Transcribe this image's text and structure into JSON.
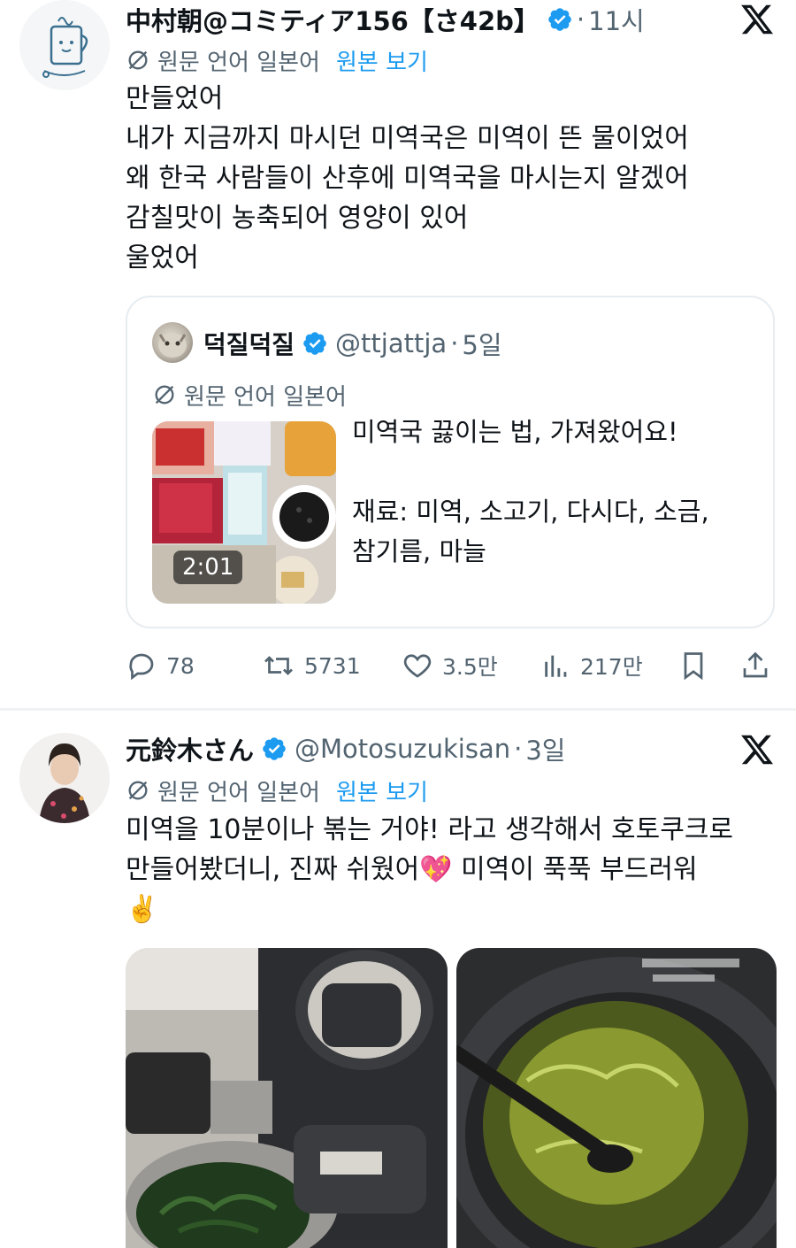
{
  "colors": {
    "text": "#0f1419",
    "secondary": "#536471",
    "link": "#1d9bf0",
    "verified": "#1d9bf0",
    "border": "#e6ecf0"
  },
  "tweets": [
    {
      "name": "中村朝@コミティア156【さ42b】",
      "verified": true,
      "dot": "·",
      "time": "11시",
      "translation": {
        "label": "원문 언어 일본어",
        "link": "원본 보기"
      },
      "body": [
        "만들었어",
        "내가 지금까지 마시던 미역국은 미역이 뜬 물이었어",
        "왜 한국 사람들이 산후에 미역국을 마시는지 알겠어",
        "감칠맛이 농축되어 영양이 있어",
        "울었어"
      ],
      "quote": {
        "name": "덕질덕질",
        "verified": true,
        "handle": "@ttjattja",
        "dot": "·",
        "time": "5일",
        "translation_label": "원문 언어 일본어",
        "video_duration": "2:01",
        "text": [
          "미역국 끓이는 법, 가져왔어요!",
          "",
          "재료: 미역, 소고기, 다시다, 소금,",
          "참기름, 마늘"
        ]
      },
      "actions": {
        "replies": "78",
        "reposts": "5731",
        "likes": "3.5만",
        "views": "217만"
      }
    },
    {
      "name": "元鈴木さん",
      "verified": true,
      "handle": "@Motosuzukisan",
      "dot": "·",
      "time": "3일",
      "translation": {
        "label": "원문 언어 일본어",
        "link": "원본 보기"
      },
      "body": [
        "미역을 10분이나 볶는 거야! 라고 생각해서 호토쿠크로",
        "만들어봤더니, 진짜 쉬웠어",
        " 미역이 푹푹 부드러워"
      ],
      "emoji": {
        "sparkle_heart": "💖",
        "victory": "✌️"
      }
    }
  ]
}
